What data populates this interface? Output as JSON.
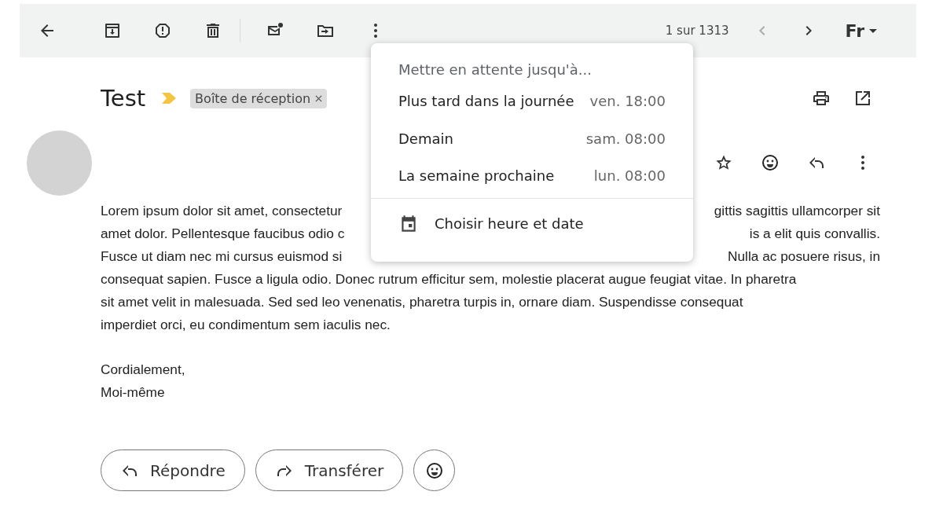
{
  "toolbar": {
    "position": "1 sur 1313",
    "input_tool": "Fr",
    "nav": [
      {
        "kind": "prev",
        "disabled": true
      },
      {
        "kind": "next",
        "disabled": false
      }
    ]
  },
  "message": {
    "subject": "Test",
    "label": "Boîte de réception",
    "body": [
      {
        "parts": [
          "Lorem ipsum dolor sit amet, consectetur",
          "gittis sagittis ullamcorper sit"
        ]
      },
      {
        "parts": [
          "amet dolor. Pellentesque faucibus odio c",
          "is a elit quis convallis."
        ]
      },
      {
        "parts": [
          "Fusce ut diam nec mi cursus euismod si",
          "Nulla ac posuere risus, in"
        ]
      },
      {
        "parts": [
          "consequat sapien. Fusce a ligula odio. Donec rutrum efficitur sem, molestie placerat augue feugiat vitae. In pharetra"
        ]
      },
      {
        "parts": [
          "sit amet velit in malesuada. Sed sed leo venenatis, pharetra turpis in, ornare diam. Suspendisse consequat"
        ]
      },
      {
        "parts": [
          "imperdiet orci, eu condimentum sem iaculis nec."
        ]
      }
    ],
    "signature": [
      "Cordialement,",
      "Moi-même"
    ],
    "actions": [
      {
        "kind": "reply",
        "label": "Répondre"
      },
      {
        "kind": "forward",
        "label": "Transférer"
      }
    ]
  },
  "snooze_menu": {
    "title": "Mettre en attente jusqu'à...",
    "options": [
      {
        "label": "Plus tard dans la journée",
        "time": "ven. 18:00"
      },
      {
        "label": "Demain",
        "time": "sam. 08:00"
      },
      {
        "label": "La semaine prochaine",
        "time": "lun. 08:00"
      }
    ],
    "custom": "Choisir heure et date"
  }
}
